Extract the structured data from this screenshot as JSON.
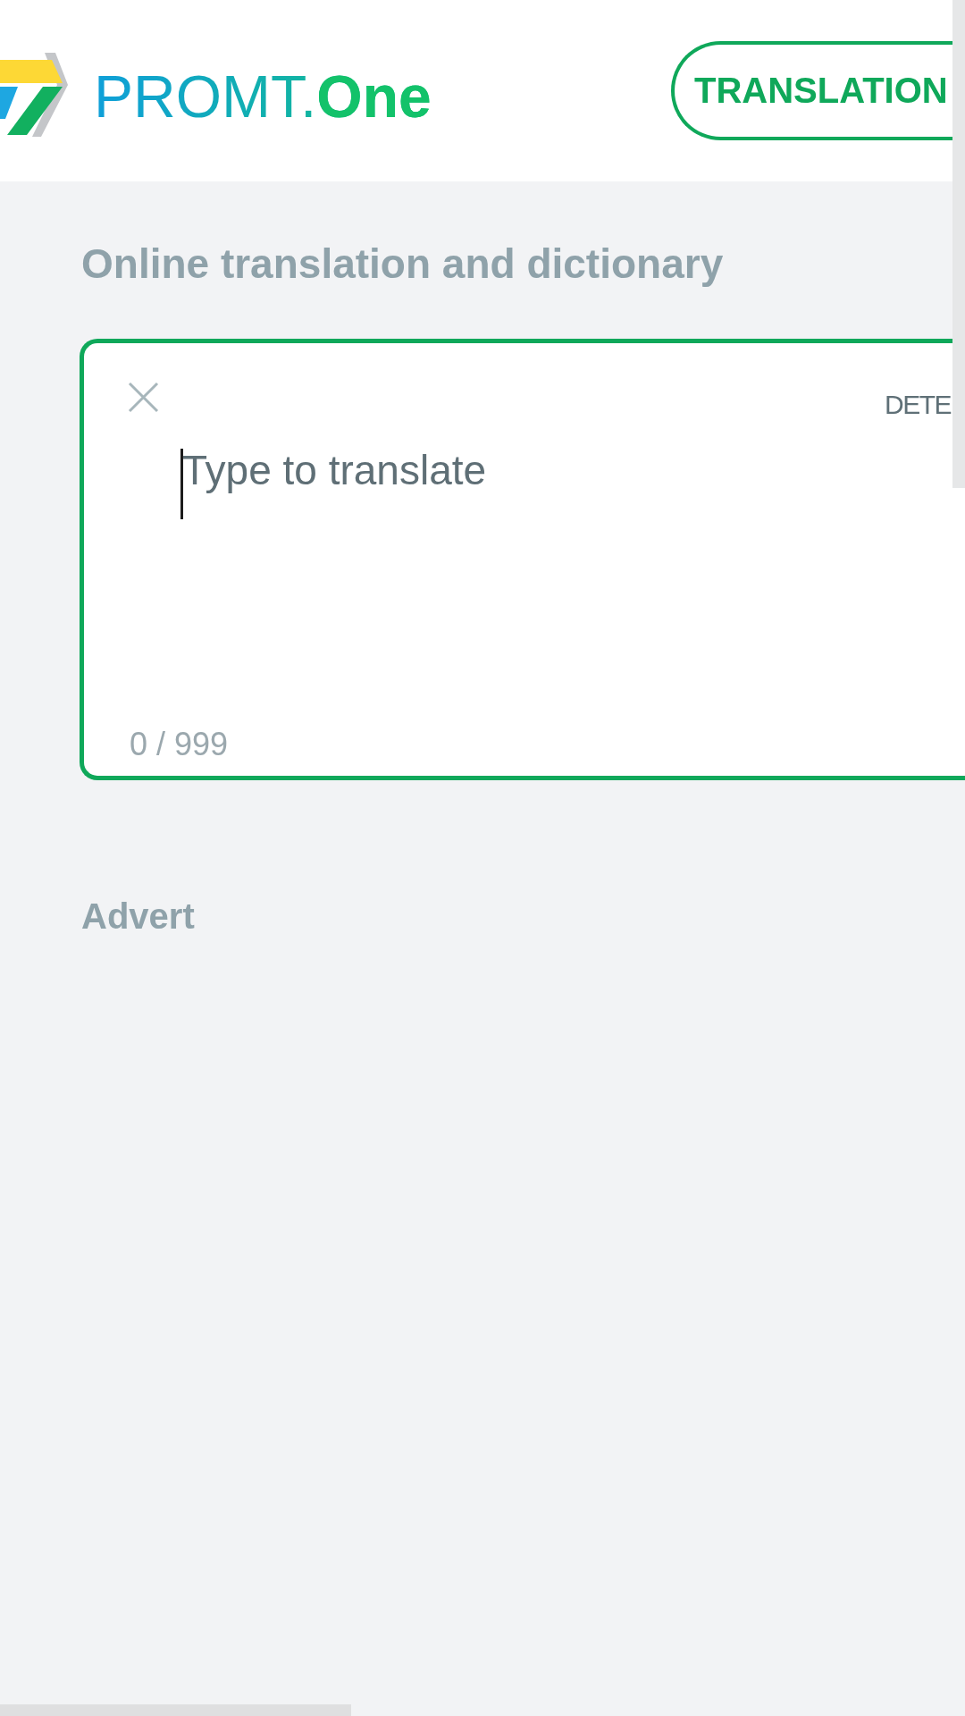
{
  "header": {
    "logo": "PROMT.**One**",
    "nav_button": "TRANSLATION"
  },
  "heading": "Online translation and dictionary",
  "translator": {
    "source_language": "DETE",
    "input": {
      "placeholder": "Type to translate",
      "focused": true
    },
    "counter": "0 / 999"
  },
  "advert": {
    "title": "Advert"
  }
}
